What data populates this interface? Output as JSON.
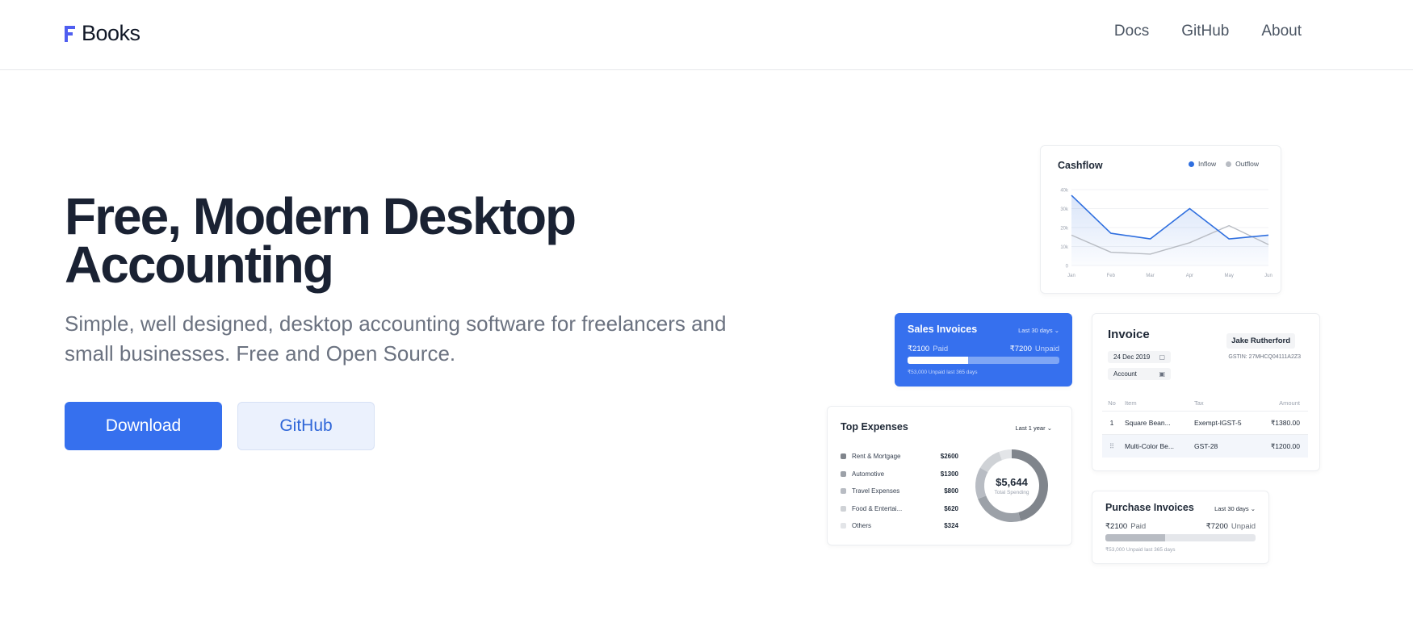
{
  "header": {
    "logo_text": "Books",
    "nav": [
      "Docs",
      "GitHub",
      "About"
    ]
  },
  "hero": {
    "title_line1": "Free, Modern Desktop",
    "title_line2": "Accounting",
    "subtitle": "Simple, well designed, desktop accounting software for freelancers and small businesses. Free and Open Source.",
    "download_label": "Download",
    "github_label": "GitHub"
  },
  "colors": {
    "primary": "#3670ee",
    "inflow": "#2f6fdf",
    "outflow": "#b8bcc3"
  },
  "cashflow": {
    "title": "Cashflow",
    "legend": [
      "Inflow",
      "Outflow"
    ]
  },
  "chart_data": {
    "type": "line",
    "title": "Cashflow",
    "categories": [
      "Jan",
      "Feb",
      "Mar",
      "Apr",
      "May",
      "Jun"
    ],
    "y_ticks": [
      "40k",
      "30k",
      "20k",
      "10k",
      "0"
    ],
    "ylim": [
      0,
      40
    ],
    "series": [
      {
        "name": "Inflow",
        "values": [
          37,
          17,
          14,
          30,
          14,
          16
        ]
      },
      {
        "name": "Outflow",
        "values": [
          16,
          7,
          6,
          12,
          21,
          11
        ]
      }
    ]
  },
  "sales_invoices": {
    "title": "Sales Invoices",
    "range": "Last 30 days",
    "paid_amount": "₹2100",
    "paid_label": "Paid",
    "unpaid_amount": "₹7200",
    "unpaid_label": "Unpaid",
    "note": "₹53,000 Unpaid last 365 days",
    "paid_fraction": 0.4
  },
  "invoice": {
    "title": "Invoice",
    "party": "Jake Rutherford",
    "date": "24 Dec 2019",
    "account": "Account",
    "gstin": "GSTIN: 27MHCQ04111A2Z3",
    "columns": [
      "No",
      "Item",
      "Tax",
      "Amount"
    ],
    "rows": [
      {
        "no": "1",
        "item": "Square Bean...",
        "tax": "Exempt-IGST-5",
        "amount": "₹1380.00"
      },
      {
        "no": "⠿",
        "item": "Multi-Color Be...",
        "tax": "GST-28",
        "amount": "₹1200.00"
      }
    ]
  },
  "top_expenses": {
    "title": "Top Expenses",
    "range": "Last 1 year",
    "items": [
      {
        "name": "Rent & Mortgage",
        "value": "$2600",
        "amount": 2600,
        "color": "#80858c"
      },
      {
        "name": "Automotive",
        "value": "$1300",
        "amount": 1300,
        "color": "#9ca1a8"
      },
      {
        "name": "Travel Expenses",
        "value": "$800",
        "amount": 800,
        "color": "#b8bcc3"
      },
      {
        "name": "Food & Entertai...",
        "value": "$620",
        "amount": 620,
        "color": "#cfd2d6"
      },
      {
        "name": "Others",
        "value": "$324",
        "amount": 324,
        "color": "#e3e5e8"
      }
    ],
    "total": "$5,644",
    "total_label": "Total Spending"
  },
  "purchase_invoices": {
    "title": "Purchase Invoices",
    "range": "Last 30 days",
    "paid_amount": "₹2100",
    "paid_label": "Paid",
    "unpaid_amount": "₹7200",
    "unpaid_label": "Unpaid",
    "note": "₹53,000 Unpaid last 365 days",
    "paid_fraction": 0.4
  }
}
